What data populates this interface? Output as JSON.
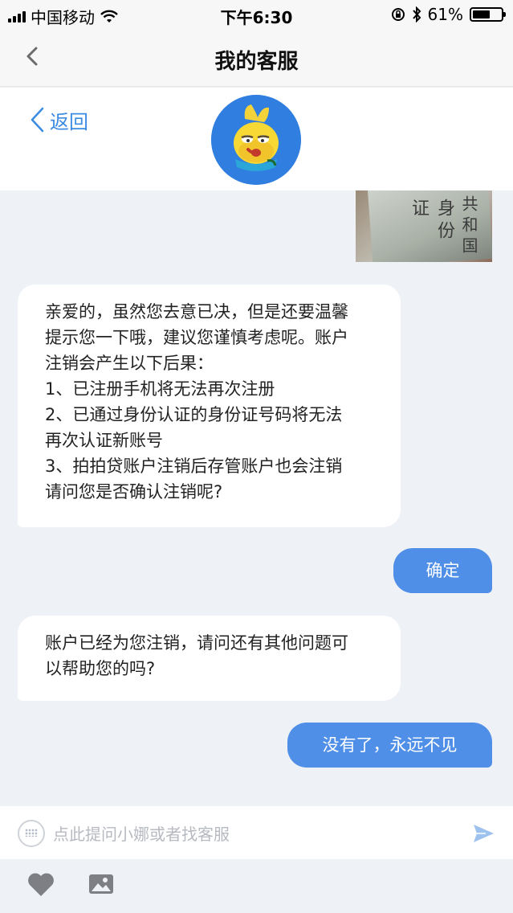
{
  "status_bar": {
    "carrier": "中国移动",
    "time": "下午6:30",
    "battery": "61%",
    "battery_level": 0.61
  },
  "nav": {
    "title": "我的客服"
  },
  "sub_header": {
    "back_label": "返回"
  },
  "photo": {
    "lines": [
      "共和国",
      "身份证"
    ]
  },
  "messages": [
    {
      "from": "agent",
      "lines": [
        "亲爱的，虽然您去意已决，但是还要温馨",
        "提示您一下哦，建议您谨慎考虑呢。账户",
        "注销会产生以下后果：",
        "1、已注册手机将无法再次注册",
        "2、已通过身份认证的身份证号码将无法",
        "再次认证新账号",
        "3、拍拍贷账户注销后存管账户也会注销",
        "请问您是否确认注销呢?"
      ]
    },
    {
      "from": "user",
      "text": "确定"
    },
    {
      "from": "agent",
      "lines": [
        "账户已经为您注销，请问还有其他问题可",
        "以帮助您的吗?"
      ]
    },
    {
      "from": "user",
      "text": "没有了，永远不见"
    }
  ],
  "input": {
    "placeholder": "点此提问小娜或者找客服"
  },
  "colors": {
    "accent": "#4f8fe7",
    "link": "#3b8be3",
    "chat_bg": "#eef1f6"
  }
}
